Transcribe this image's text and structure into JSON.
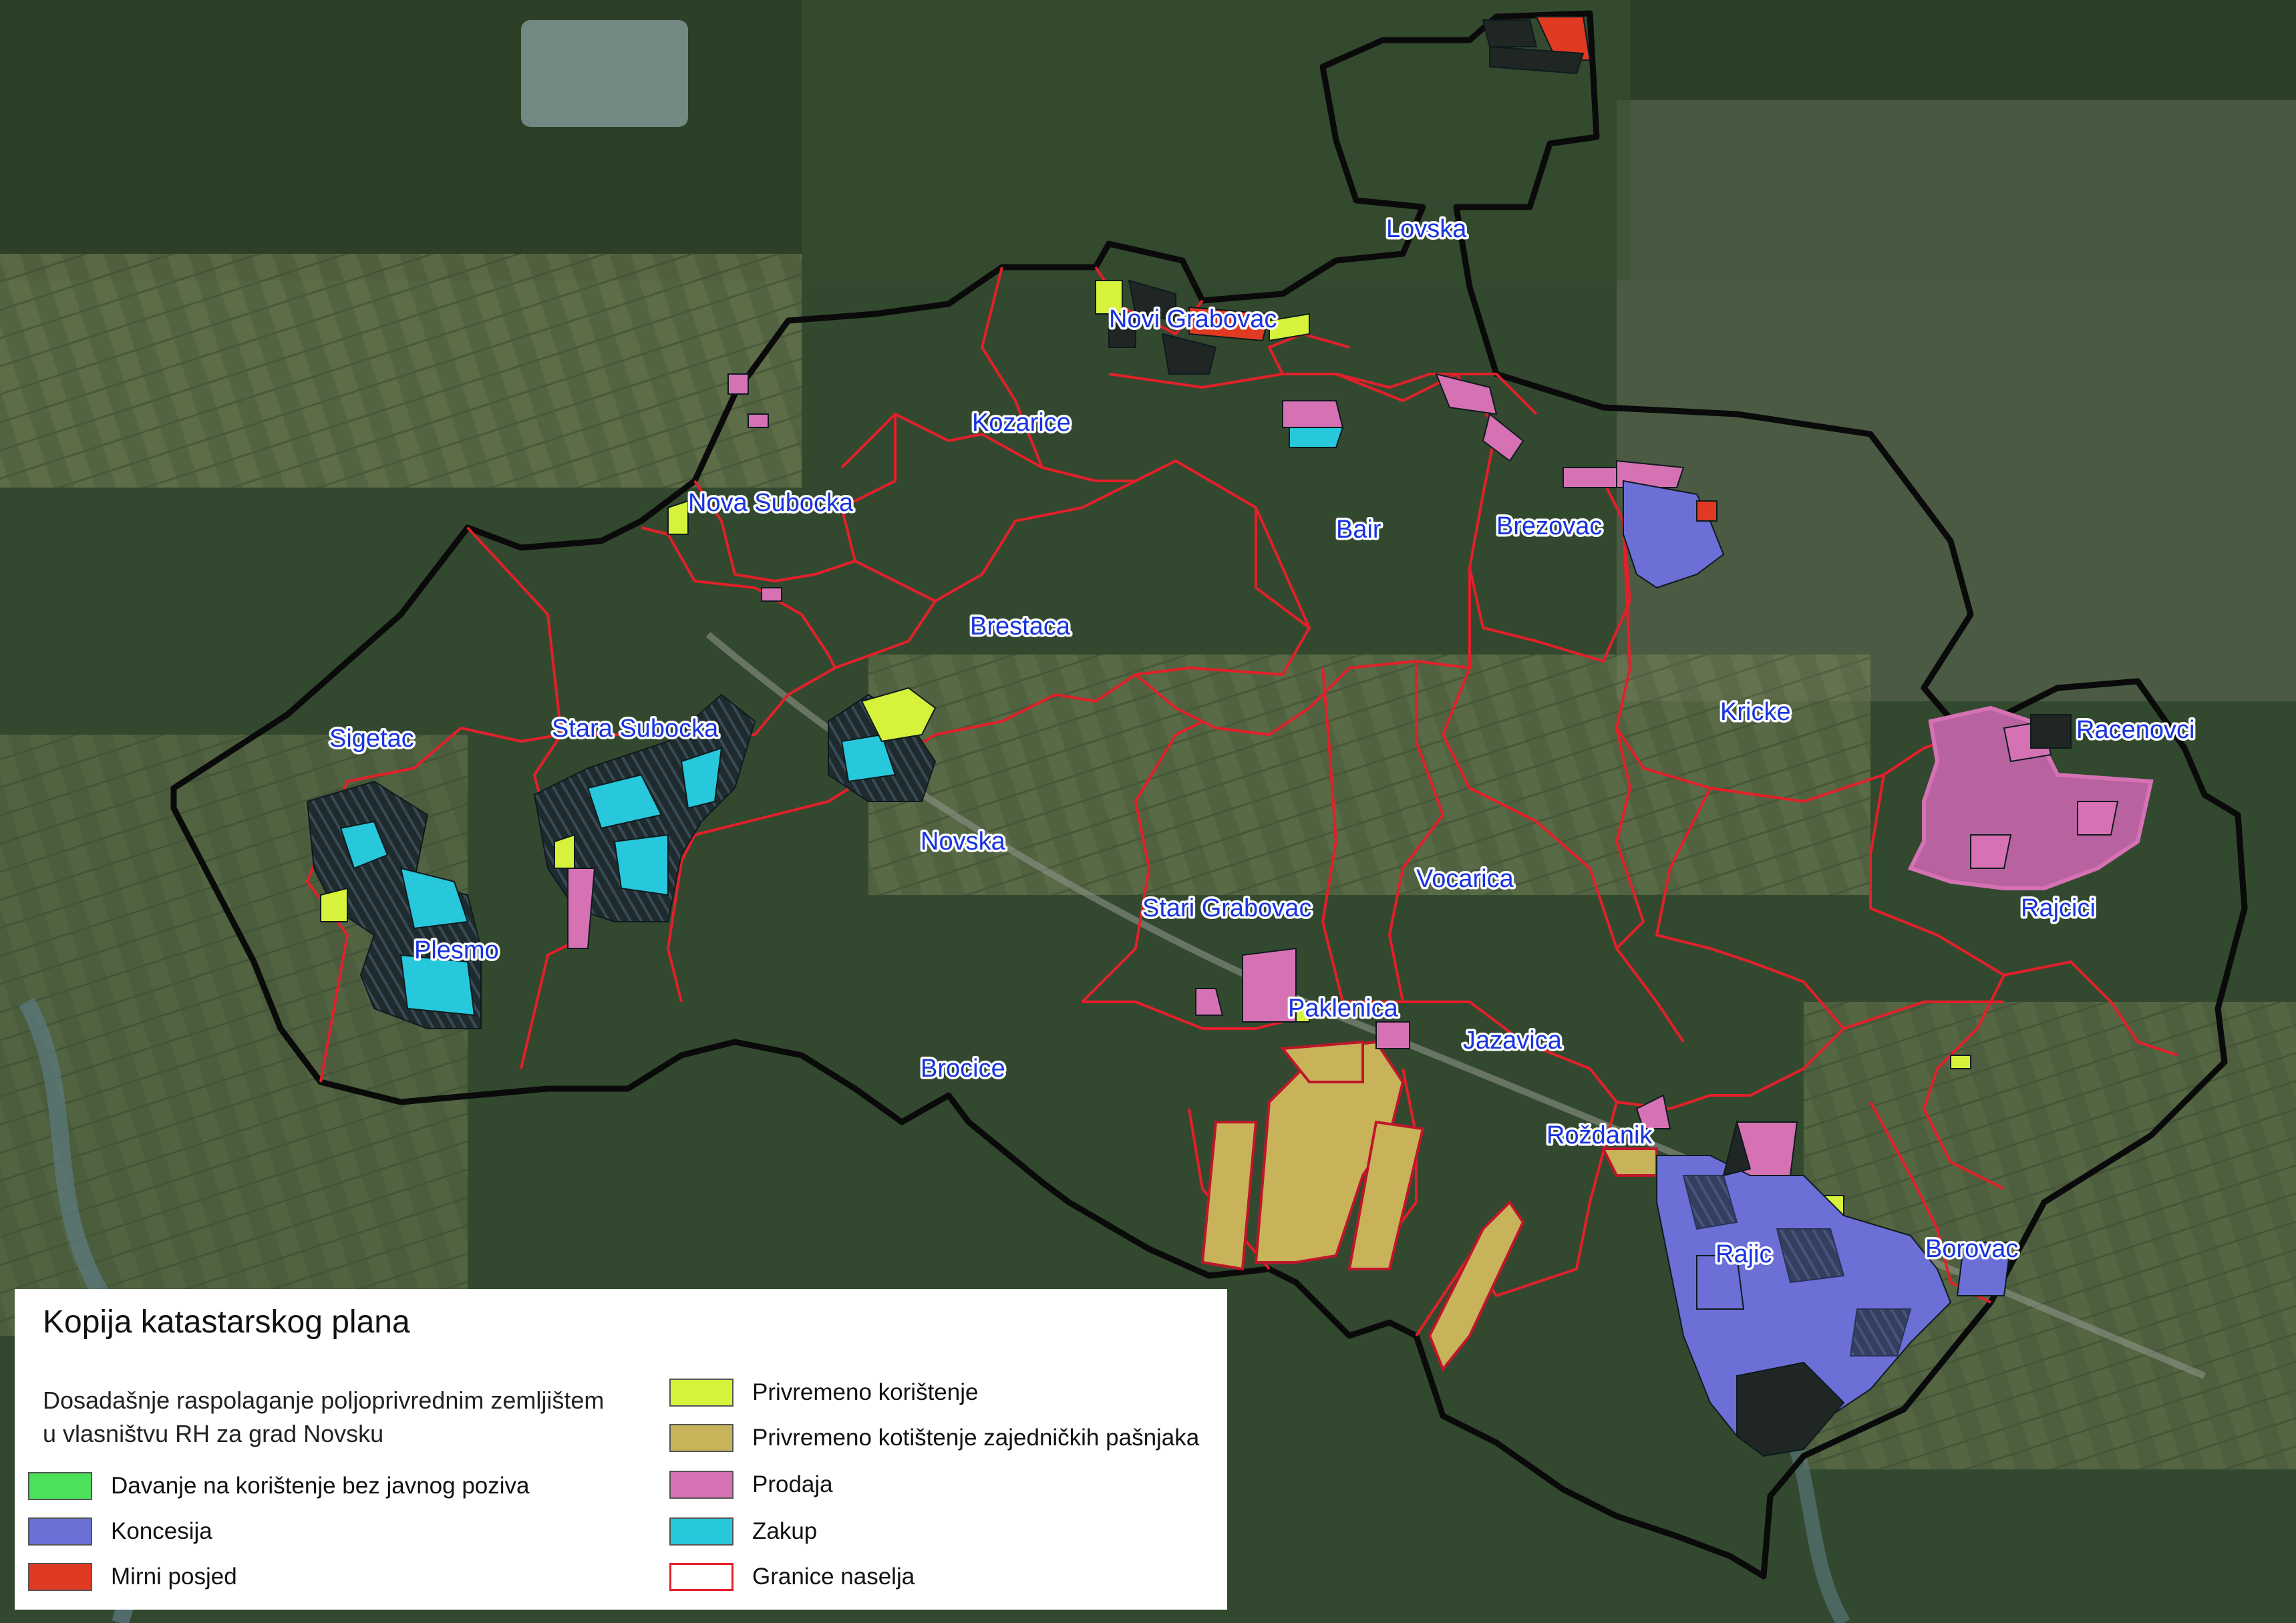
{
  "map": {
    "places": [
      "Lovska",
      "Novi Grabovac",
      "Kozarice",
      "Nova Subocka",
      "Bair",
      "Brezovac",
      "Brestaca",
      "Sigetac",
      "Stara Subocka",
      "Kricke",
      "Racenovci",
      "Novska",
      "Stari Grabovac",
      "Vocarica",
      "Rajcici",
      "Plesmo",
      "Paklenica",
      "Jazavica",
      "Brocice",
      "Roždanik",
      "Rajic",
      "Borovac"
    ]
  },
  "legend": {
    "title": "Kopija katastarskog plana",
    "subtitle_line1": "Dosadašnje raspolaganje poljoprivrednim zemljištem",
    "subtitle_line2": "u vlasništvu RH za grad Novsku",
    "items": [
      {
        "label": "Davanje na korištenje bez javnog poziva",
        "color": "#4de05a"
      },
      {
        "label": "Koncesija",
        "color": "#6b6fd6"
      },
      {
        "label": "Mirni posjed",
        "color": "#e03a22"
      },
      {
        "label": "Privremeno korištenje",
        "color": "#d6f23a"
      },
      {
        "label": "Privremeno kotištenje zajedničkih pašnjaka",
        "color": "#c8b35a"
      },
      {
        "label": "Prodaja",
        "color": "#d672b4"
      },
      {
        "label": "Zakup",
        "color": "#27c7dc"
      },
      {
        "label": "Granice naselja",
        "color": "#e3202a"
      }
    ]
  }
}
